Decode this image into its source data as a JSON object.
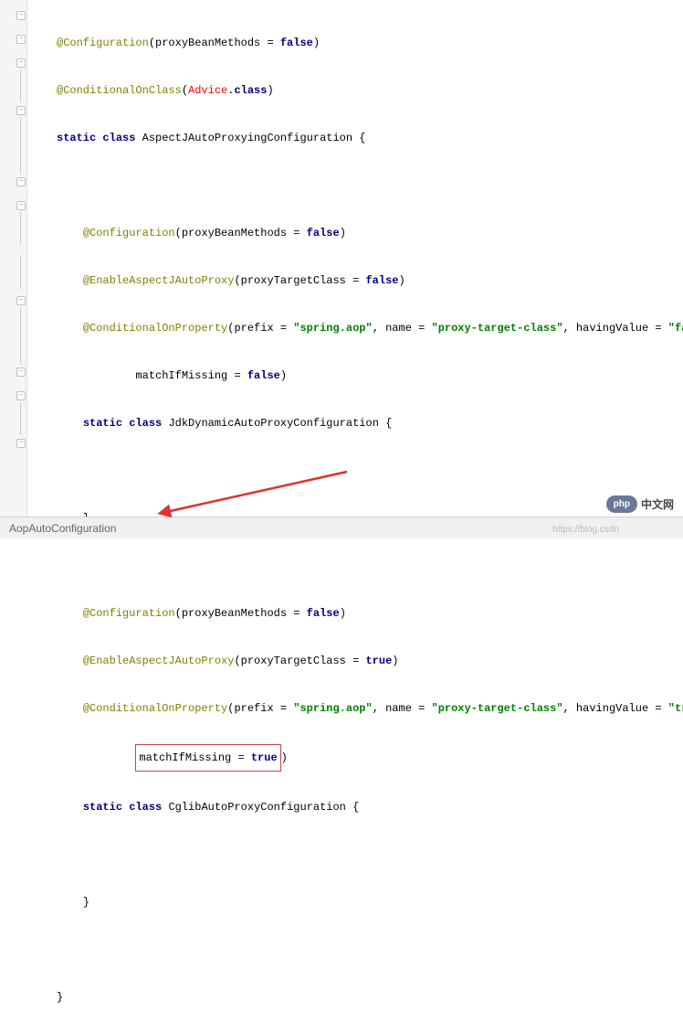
{
  "code": {
    "l1_ann": "@Configuration",
    "l1_param": "(proxyBeanMethods = ",
    "l1_val": "false",
    "l1_end": ")",
    "l2_ann": "@ConditionalOnClass",
    "l2_open": "(",
    "l2_advice": "Advice",
    "l2_dot": ".",
    "l2_class": "class",
    "l2_close": ")",
    "l3_static": "static",
    "l3_class": "class",
    "l3_name": " AspectJAutoProxyingConfiguration {",
    "l5_ann": "@Configuration",
    "l5_param": "(proxyBeanMethods = ",
    "l5_val": "false",
    "l5_end": ")",
    "l6_ann": "@EnableAspectJAutoProxy",
    "l6_param": "(proxyTargetClass = ",
    "l6_val": "false",
    "l6_end": ")",
    "l7_ann": "@ConditionalOnProperty",
    "l7_open": "(prefix = ",
    "l7_str1": "\"spring.aop\"",
    "l7_c1": ", name = ",
    "l7_str2": "\"proxy-target-class\"",
    "l7_c2": ", havingValue = ",
    "l7_str3": "\"false\"",
    "l7_end": ",",
    "l8_param": "matchIfMissing = ",
    "l8_val": "false",
    "l8_end": ")",
    "l9_static": "static",
    "l9_class": "class",
    "l9_name": " JdkDynamicAutoProxyConfiguration {",
    "l11_close": "}",
    "l13_ann": "@Configuration",
    "l13_param": "(proxyBeanMethods = ",
    "l13_val": "false",
    "l13_end": ")",
    "l14_ann": "@EnableAspectJAutoProxy",
    "l14_param": "(proxyTargetClass = ",
    "l14_val": "true",
    "l14_end": ")",
    "l15_ann": "@ConditionalOnProperty",
    "l15_open": "(prefix = ",
    "l15_str1": "\"spring.aop\"",
    "l15_c1": ", name = ",
    "l15_str2": "\"proxy-target-class\"",
    "l15_c2": ", havingValue = ",
    "l15_str3": "\"true\"",
    "l15_end": ",",
    "l16_param": "matchIfMissing = ",
    "l16_val": "true",
    "l16_end": ")",
    "l17_static": "static",
    "l17_class": "class",
    "l17_name": " CglibAutoProxyConfiguration {",
    "l19_close": "}",
    "l21_close": "}"
  },
  "breadcrumb": "AopAutoConfiguration",
  "watermark": {
    "php": "php",
    "cn": "中文网"
  }
}
